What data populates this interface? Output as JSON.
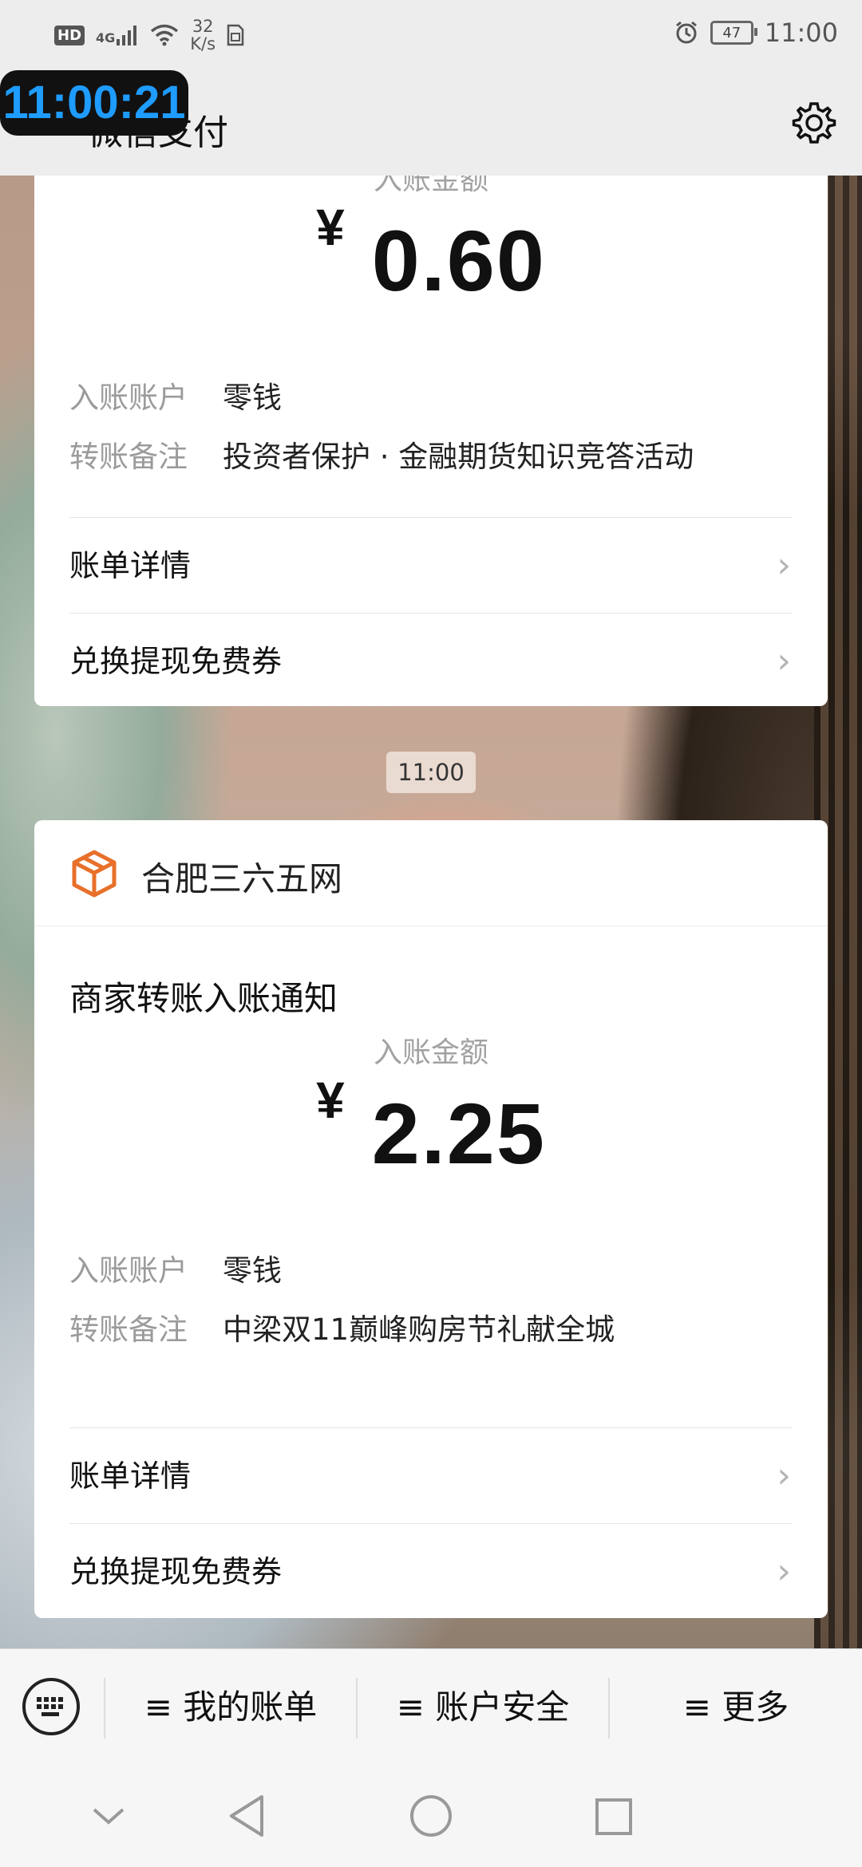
{
  "status_bar": {
    "hd": "HD",
    "network": "4G",
    "speed_value": "32",
    "speed_unit": "K/s",
    "battery": "47",
    "time": "11:00"
  },
  "clock_overlay": "11:00:21",
  "header": {
    "title": "微信支付"
  },
  "card1": {
    "amount_label": "入账金额",
    "currency": "¥",
    "amount": "0.60",
    "account_label": "入账账户",
    "account_value": "零钱",
    "remark_label": "转账备注",
    "remark_value": "投资者保护 · 金融期货知识竞答活动",
    "links": [
      "账单详情",
      "兑换提现免费券"
    ]
  },
  "time_divider": "11:00",
  "card2": {
    "merchant": "合肥三六五网",
    "notice_title": "商家转账入账通知",
    "amount_label": "入账金额",
    "currency": "¥",
    "amount": "2.25",
    "account_label": "入账账户",
    "account_value": "零钱",
    "remark_label": "转账备注",
    "remark_value": "中梁双11巅峰购房节礼献全城",
    "links": [
      "账单详情",
      "兑换提现免费券"
    ]
  },
  "bottom_menu": {
    "items": [
      "≡ 我的账单",
      "≡ 账户安全",
      "≡ 更多"
    ]
  },
  "colors": {
    "merchant_logo": "#e8702a",
    "clock_text": "#1e9cff"
  }
}
